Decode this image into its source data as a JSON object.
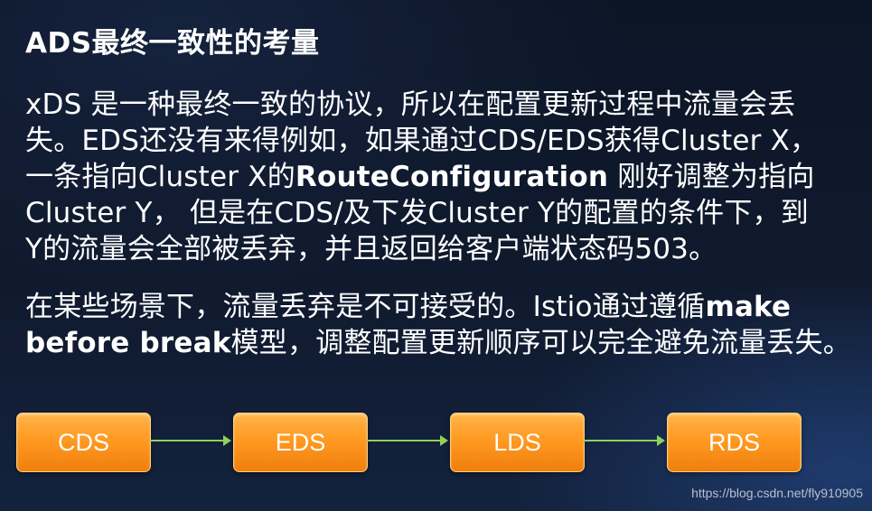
{
  "slide": {
    "title": "ADS最终一致性的考量",
    "paragraph1": {
      "line1": "xDS 是一种最终一致的协议，所以在配置更新过程中流量会丢",
      "line2": "失。EDS还没有来得例如，如果通过CDS/EDS获得Cluster X，",
      "line3_prefix": "一条指向Cluster X的",
      "line3_bold": "RouteConfiguration",
      "line3_suffix": " 刚好调整为指向",
      "line4": "Cluster Y， 但是在CDS/及下发Cluster Y的配置的条件下，到",
      "line5": "Y的流量会全部被丢弃，并且返回给客户端状态码503。"
    },
    "paragraph2": {
      "line1_prefix": "在某些场景下，流量丢弃是不可接受的。Istio通过遵循",
      "line1_bold": "make",
      "line2_bold": "before break",
      "line2_suffix": "模型，调整配置更新顺序可以完全避免流量丢失。"
    }
  },
  "flow": {
    "steps": [
      "CDS",
      "EDS",
      "LDS",
      "RDS"
    ],
    "box_color": "#ff9a22",
    "arrow_color": "#8fd15a"
  },
  "watermark": "https://blog.csdn.net/fly910905"
}
